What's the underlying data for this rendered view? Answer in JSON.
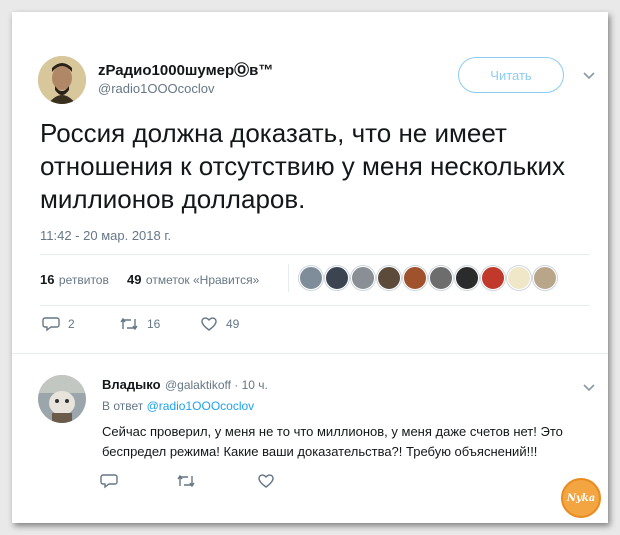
{
  "tweet": {
    "display_name": "zРадио1000шумерⓄв™",
    "handle": "@radio1OOOcoclov",
    "follow_label": "Читать",
    "text": "Россия должна доказать, что не имеет отношения к отсутствию у меня нескольких миллионов долларов.",
    "timestamp": "11:42 - 20 мар. 2018 г.",
    "retweets_count": "16",
    "retweets_label": "ретвитов",
    "likes_count": "49",
    "likes_label": "отметок «Нравится»",
    "actions": {
      "reply_count": "2",
      "retweet_count": "16",
      "like_count": "49"
    }
  },
  "reply": {
    "display_name": "Владыко",
    "handle_time": "@galaktikoff · 10 ч.",
    "in_reply_prefix": "В ответ",
    "in_reply_handle": "@radio1OOOcoclov",
    "text": "Сейчас проверил, у меня не то что миллионов, у меня даже счетов нет! Это беспредел режима! Какие ваши доказательства?! Требую объяснений!!!"
  },
  "watermark": "Nyka",
  "icons": {
    "reply": "speech-bubble-icon",
    "retweet": "retweet-arrows-icon",
    "like": "heart-icon",
    "more": "chevron-down-icon"
  },
  "colors": {
    "accent": "#1da1f2",
    "follow_border": "#8ecbf2",
    "muted": "#657786"
  }
}
